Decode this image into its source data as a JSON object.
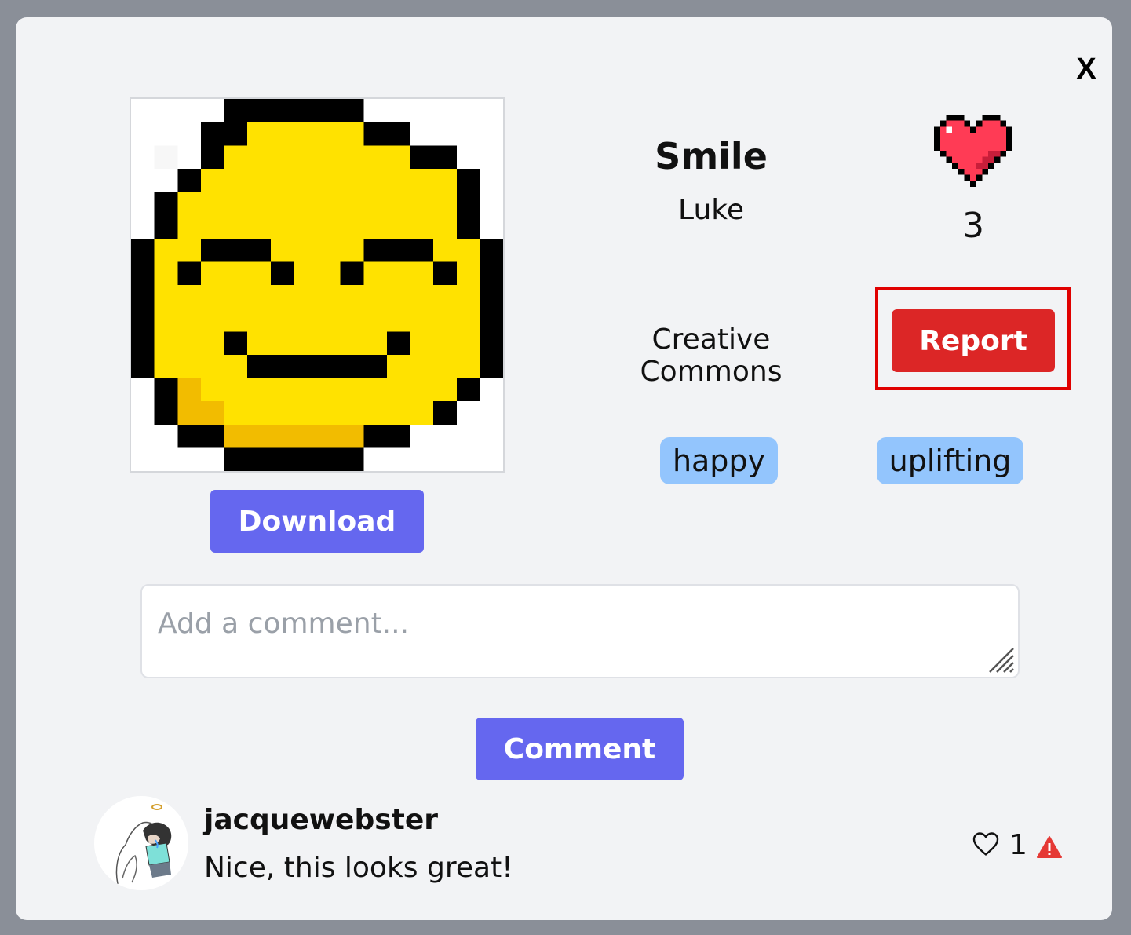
{
  "modal": {
    "close_label": "X"
  },
  "artwork": {
    "title": "Smile",
    "author": "Luke",
    "likes": "3",
    "license": "Creative Commons",
    "report_label": "Report",
    "download_label": "Download",
    "tags": [
      "happy",
      "uplifting"
    ],
    "icon": "pixel-smiley-face"
  },
  "comment_form": {
    "placeholder": "Add a comment...",
    "value": "",
    "submit_label": "Comment"
  },
  "comments": [
    {
      "username": "jacquewebster",
      "text": "Nice, this looks great!",
      "likes": "1"
    }
  ],
  "colors": {
    "primary": "#6567ef",
    "danger": "#dc2626",
    "tag": "#93c5fd",
    "heart": "#ff3b55",
    "highlight": "#e00000"
  }
}
